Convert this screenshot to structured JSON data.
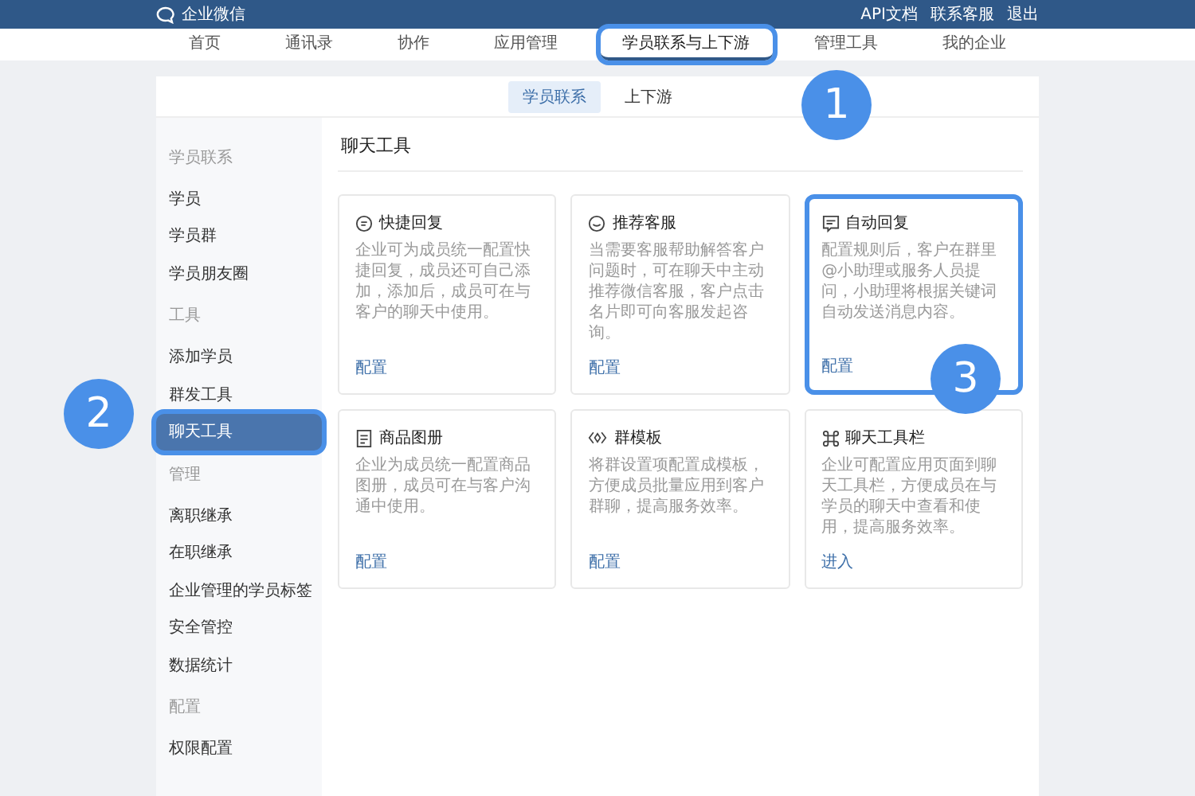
{
  "topbar": {
    "logo_text": "企业微信",
    "links": [
      "API文档",
      "联系客服",
      "退出"
    ]
  },
  "nav": [
    {
      "label": "首页",
      "selected": false,
      "highlighted": false
    },
    {
      "label": "通讯录",
      "selected": false,
      "highlighted": false
    },
    {
      "label": "协作",
      "selected": false,
      "highlighted": false
    },
    {
      "label": "应用管理",
      "selected": false,
      "highlighted": false
    },
    {
      "label": "学员联系与上下游",
      "selected": true,
      "highlighted": true
    },
    {
      "label": "管理工具",
      "selected": false,
      "highlighted": false
    },
    {
      "label": "我的企业",
      "selected": false,
      "highlighted": false
    }
  ],
  "subtabs": [
    {
      "label": "学员联系",
      "selected": true
    },
    {
      "label": "上下游",
      "selected": false
    }
  ],
  "sidebar": [
    {
      "kind": "header",
      "label": "学员联系"
    },
    {
      "kind": "item",
      "label": "学员",
      "selected": false,
      "highlighted": false
    },
    {
      "kind": "item",
      "label": "学员群",
      "selected": false,
      "highlighted": false
    },
    {
      "kind": "item",
      "label": "学员朋友圈",
      "selected": false,
      "highlighted": false
    },
    {
      "kind": "header",
      "label": "工具"
    },
    {
      "kind": "item",
      "label": "添加学员",
      "selected": false,
      "highlighted": false
    },
    {
      "kind": "item",
      "label": "群发工具",
      "selected": false,
      "highlighted": false
    },
    {
      "kind": "item",
      "label": "聊天工具",
      "selected": true,
      "highlighted": true
    },
    {
      "kind": "header",
      "label": "管理"
    },
    {
      "kind": "item",
      "label": "离职继承",
      "selected": false,
      "highlighted": false
    },
    {
      "kind": "item",
      "label": "在职继承",
      "selected": false,
      "highlighted": false
    },
    {
      "kind": "item",
      "label": "企业管理的学员标签",
      "selected": false,
      "highlighted": false
    },
    {
      "kind": "item",
      "label": "安全管控",
      "selected": false,
      "highlighted": false
    },
    {
      "kind": "item",
      "label": "数据统计",
      "selected": false,
      "highlighted": false
    },
    {
      "kind": "header",
      "label": "配置"
    },
    {
      "kind": "item",
      "label": "权限配置",
      "selected": false,
      "highlighted": false
    }
  ],
  "content": {
    "title": "聊天工具",
    "cards": [
      {
        "kind": "chat",
        "title": "快捷回复",
        "description": "企业可为成员统一配置快捷回复，成员还可自己添加，添加后，成员可在与客户的聊天中使用。",
        "action": "配置",
        "highlighted": false
      },
      {
        "kind": "service",
        "title": "推荐客服",
        "description": "当需要客服帮助解答客户问题时，可在聊天中主动推荐微信客服，客户点击名片即可向客服发起咨询。",
        "action": "配置",
        "highlighted": false
      },
      {
        "kind": "auto",
        "title": "自动回复",
        "description": "配置规则后，客户在群里@小助理或服务人员提问，小助理将根据关键词自动发送消息内容。",
        "action": "配置",
        "highlighted": true
      },
      {
        "kind": "album",
        "title": "商品图册",
        "description": "企业为成员统一配置商品图册，成员可在与客户沟通中使用。",
        "action": "配置",
        "highlighted": false
      },
      {
        "kind": "template",
        "title": "群模板",
        "description": "将群设置项配置成模板，方便成员批量应用到客户群聊，提高服务效率。",
        "action": "配置",
        "highlighted": false
      },
      {
        "kind": "toolbar",
        "title": "聊天工具栏",
        "description": "企业可配置应用页面到聊天工具栏，方便成员在与学员的聊天中查看和使用，提高服务效率。",
        "action": "进入",
        "highlighted": false
      }
    ]
  },
  "callouts": [
    "1",
    "2",
    "3"
  ]
}
